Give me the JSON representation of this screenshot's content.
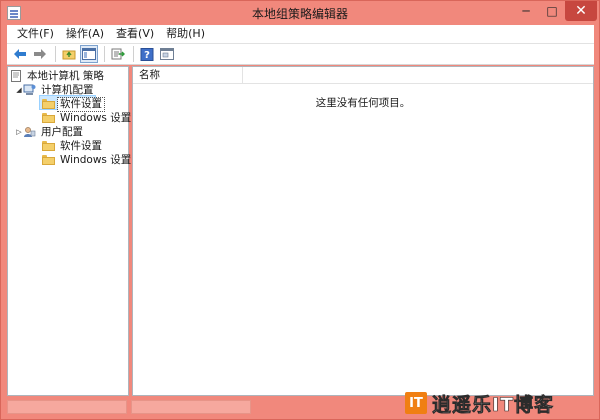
{
  "window": {
    "title": "本地组策略编辑器",
    "controls": {
      "minimize": "─",
      "maximize": "□",
      "close": "✕"
    }
  },
  "menu": [
    {
      "label": "文件(F)"
    },
    {
      "label": "操作(A)"
    },
    {
      "label": "查看(V)"
    },
    {
      "label": "帮助(H)"
    }
  ],
  "toolbar": {
    "buttons": [
      "back-arrow-icon",
      "forward-arrow-icon",
      "up-folder-icon",
      "show-hide-tree-icon",
      "export-list-icon",
      "help-icon",
      "properties-icon"
    ]
  },
  "tree": {
    "root": "本地计算机 策略",
    "computer_config": "计算机配置",
    "computer_software": "软件设置",
    "computer_windows": "Windows 设置",
    "user_config": "用户配置",
    "user_software": "软件设置",
    "user_windows": "Windows 设置"
  },
  "content": {
    "column_name": "名称",
    "empty_message": "这里没有任何项目。"
  },
  "watermark": {
    "logo_text": "IT",
    "text": "逍遥乐IT博客"
  },
  "colors": {
    "frame": "#f1887c",
    "close_button": "#c7473f",
    "selection": "#cce8ff",
    "folder": "#f4cf6a"
  }
}
